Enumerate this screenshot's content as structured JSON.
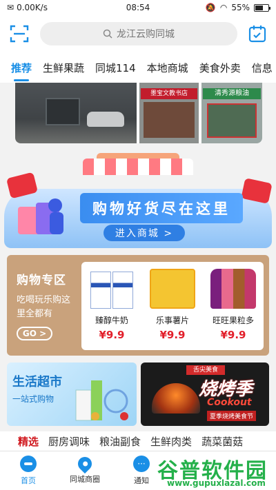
{
  "status_bar": {
    "speed": "0.00K/s",
    "time": "08:54",
    "battery": "55%"
  },
  "header": {
    "search_placeholder": "龙江云购同城"
  },
  "tabs": [
    {
      "label": "推荐",
      "active": true
    },
    {
      "label": "生鲜果蔬"
    },
    {
      "label": "同城114"
    },
    {
      "label": "本地商城"
    },
    {
      "label": "美食外卖"
    },
    {
      "label": "信息"
    }
  ],
  "photos": {
    "sign_1": "墨宝文教书店",
    "sign_2": "清秀源粮油"
  },
  "banner": {
    "title": "购物好货尽在这里",
    "enter_label": "进入商城 >"
  },
  "shopping_zone": {
    "title": "购物专区",
    "subtitle": "吃喝玩乐购这里全都有",
    "go_label": "GO >",
    "products": [
      {
        "name": "臻醇牛奶",
        "price": "¥9.9"
      },
      {
        "name": "乐事薯片",
        "price": "¥9.9"
      },
      {
        "name": "旺旺果粒多",
        "price": "¥9.9"
      }
    ]
  },
  "supermarket": {
    "title": "生活超市",
    "subtitle": "一站式购物"
  },
  "bbq": {
    "tag": "舌尖美食",
    "title": "烧烤季",
    "en": "Cookout",
    "subtitle": "夏季烧烤美食节"
  },
  "categories": [
    {
      "label": "精选",
      "active": true
    },
    {
      "label": "厨房调味"
    },
    {
      "label": "粮油副食"
    },
    {
      "label": "生鲜肉类"
    },
    {
      "label": "蔬菜菌菇"
    }
  ],
  "bottom_nav": [
    {
      "label": "首页",
      "active": true
    },
    {
      "label": "同城商圈"
    },
    {
      "label": "通知"
    }
  ],
  "watermark": {
    "name": "谷普软件园",
    "url": "www.gupuxlazal.com"
  },
  "colors": {
    "accent": "#1a8fe6",
    "price": "#e21f2a",
    "zone_bg": "#c9a27c"
  }
}
